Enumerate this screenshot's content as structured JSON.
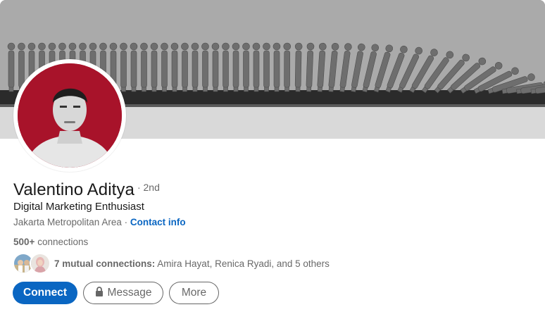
{
  "profile": {
    "name": "Valentino Aditya",
    "degree": "· 2nd",
    "headline": "Digital Marketing Enthusiast",
    "location": "Jakarta Metropolitan Area",
    "location_separator": " · ",
    "contact_info_label": "Contact info",
    "connections_count": "500+",
    "connections_label": "connections"
  },
  "mutual": {
    "count_label": "7 mutual connections:",
    "names": "Amira Hayat, Renica Ryadi, and 5 others"
  },
  "actions": {
    "connect_label": "Connect",
    "message_label": "Message",
    "more_label": "More"
  },
  "colors": {
    "accent": "#0a66c2",
    "avatar_background": "#a8132a"
  },
  "icons": {
    "message_button": "lock-icon"
  }
}
